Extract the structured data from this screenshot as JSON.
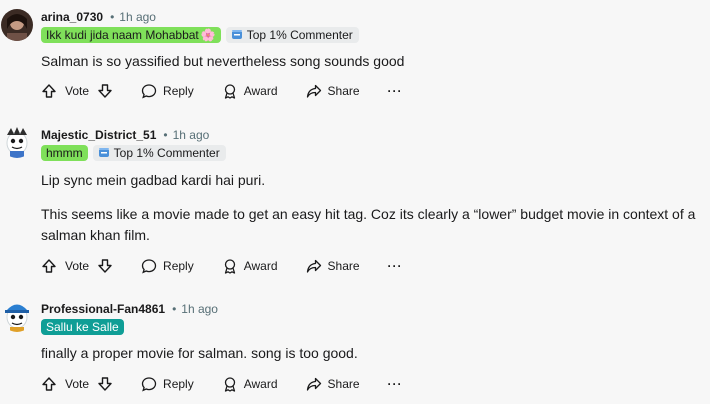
{
  "comments": [
    {
      "username": "arina_0730",
      "time": "1h ago",
      "flair": "Ikk kudi jida naam Mohabbat",
      "flair_emoji": "🌸",
      "badge": "Top 1% Commenter",
      "body": [
        "Salman is so yassified but nevertheless song sounds good"
      ]
    },
    {
      "username": "Majestic_District_51",
      "time": "1h ago",
      "flair": "hmmm",
      "badge": "Top 1% Commenter",
      "body": [
        "Lip sync mein gadbad kardi hai puri.",
        "This seems like a movie made to get an easy hit tag. Coz its clearly a “lower” budget movie in context of a",
        "salman khan film."
      ]
    },
    {
      "username": "Professional-Fan4861",
      "time": "1h ago",
      "flair": "Sallu ke Salle",
      "body": [
        "finally a proper movie for salman. song is too good."
      ]
    }
  ],
  "actions": {
    "vote": "Vote",
    "reply": "Reply",
    "award": "Award",
    "share": "Share",
    "more": "···"
  },
  "separator": "•",
  "colors": {
    "flair_green": "#7fe05a",
    "flair_teal": "#0f9e96",
    "badge_bg": "#e9ebec",
    "meta_gray": "#576f76"
  }
}
